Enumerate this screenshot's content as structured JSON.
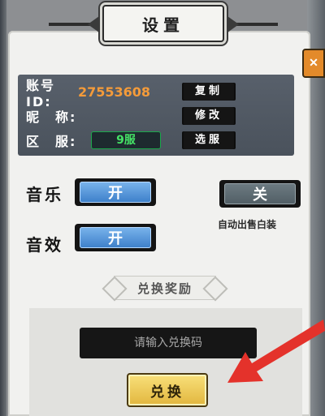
{
  "header": {
    "title": "设置"
  },
  "account": {
    "id_label": "账号ID:",
    "id_value": "27553608",
    "copy_button": "复制",
    "nickname_label": "昵　称:",
    "edit_button": "修改",
    "server_label": "区　服:",
    "server_value": "9服",
    "select_server_button": "选服"
  },
  "settings": {
    "music_label": "音乐",
    "music_state": "开",
    "sound_label": "音效",
    "sound_state": "开",
    "autosell_state": "关",
    "autosell_label": "自动出售白装"
  },
  "redeem": {
    "section_title": "兑换奖励",
    "input_placeholder": "请输入兑换码",
    "redeem_button": "兑换"
  },
  "colors": {
    "id_orange": "#f49b3a",
    "server_green": "#45e266",
    "toggle_on_blue": "#3c7fc9",
    "toggle_off_gray": "#515e65",
    "arrow_red": "#e4322b",
    "redeem_gold": "#e2b63e"
  },
  "icons": {
    "corner_badge": "close-icon"
  }
}
